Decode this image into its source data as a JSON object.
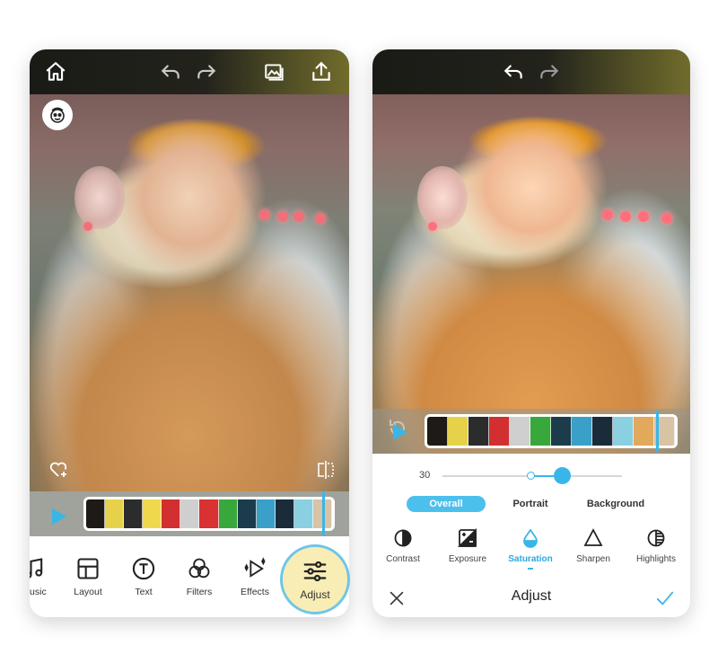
{
  "left_screen": {
    "toolbar": [
      {
        "label": "Music",
        "icon": "music-note-icon"
      },
      {
        "label": "Layout",
        "icon": "layout-icon"
      },
      {
        "label": "Text",
        "icon": "text-icon"
      },
      {
        "label": "Filters",
        "icon": "filters-icon"
      },
      {
        "label": "Effects",
        "icon": "effects-icon"
      }
    ],
    "adjust_label": "Adjust"
  },
  "right_screen": {
    "slider_value": "30",
    "slider_fraction": 0.65,
    "segments": [
      {
        "label": "Overall",
        "active": true
      },
      {
        "label": "Portrait",
        "active": false
      },
      {
        "label": "Background",
        "active": false
      }
    ],
    "tools": [
      {
        "label": "Contrast",
        "icon": "contrast-icon",
        "active": false
      },
      {
        "label": "Exposure",
        "icon": "exposure-icon",
        "active": false
      },
      {
        "label": "Saturation",
        "icon": "saturation-drop-icon",
        "active": true
      },
      {
        "label": "Sharpen",
        "icon": "sharpen-triangle-icon",
        "active": false
      },
      {
        "label": "Highlights",
        "icon": "highlights-icon",
        "active": false
      }
    ],
    "title": "Adjust"
  },
  "colors": {
    "accent": "#39b6e8",
    "adjust_bubble": "#f9edb6",
    "topbar_dark": "#1a1a16"
  }
}
